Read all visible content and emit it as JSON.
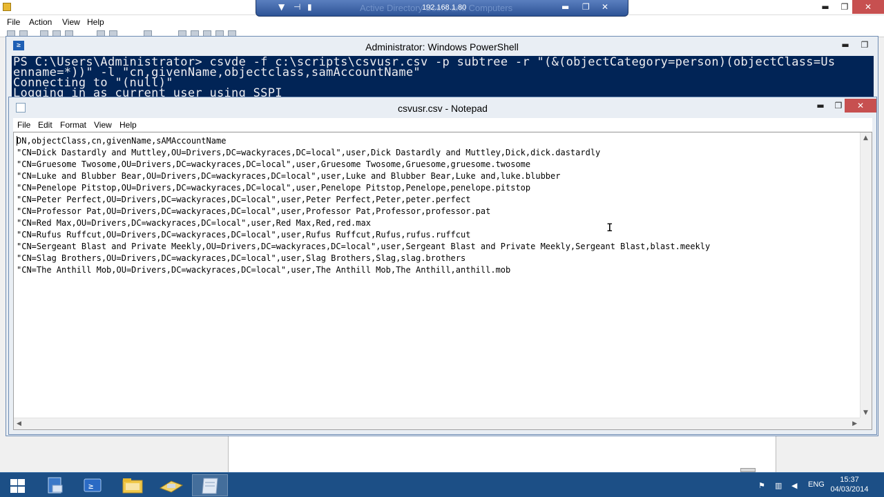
{
  "mmc": {
    "menu": [
      "File",
      "Action",
      "View",
      "Help"
    ],
    "rdp_ip": "192.168.1.80",
    "rdp_ghost_title": "Active Directory Users and Computers"
  },
  "powershell": {
    "title": "Administrator: Windows PowerShell",
    "icon_glyph": "≥",
    "lines": [
      "PS C:\\Users\\Administrator> csvde -f c:\\scripts\\csvusr.csv -p subtree -r \"(&(objectCategory=person)(objectClass=Us",
      "enname=*))\" -l \"cn,givenName,objectclass,samAccountName\"",
      "Connecting to \"(null)\"",
      "Logging in as current user using SSPI"
    ]
  },
  "notepad": {
    "title": "csvusr.csv - Notepad",
    "menu": [
      "File",
      "Edit",
      "Format",
      "View",
      "Help"
    ],
    "lines": [
      "DN,objectClass,cn,givenName,sAMAccountName",
      "\"CN=Dick Dastardly and Muttley,OU=Drivers,DC=wackyraces,DC=local\",user,Dick Dastardly and Muttley,Dick,dick.dastardly",
      "\"CN=Gruesome Twosome,OU=Drivers,DC=wackyraces,DC=local\",user,Gruesome Twosome,Gruesome,gruesome.twosome",
      "\"CN=Luke and Blubber Bear,OU=Drivers,DC=wackyraces,DC=local\",user,Luke and Blubber Bear,Luke and,luke.blubber",
      "\"CN=Penelope Pitstop,OU=Drivers,DC=wackyraces,DC=local\",user,Penelope Pitstop,Penelope,penelope.pitstop",
      "\"CN=Peter Perfect,OU=Drivers,DC=wackyraces,DC=local\",user,Peter Perfect,Peter,peter.perfect",
      "\"CN=Professor Pat,OU=Drivers,DC=wackyraces,DC=local\",user,Professor Pat,Professor,professor.pat",
      "\"CN=Red Max,OU=Drivers,DC=wackyraces,DC=local\",user,Red Max,Red,red.max",
      "\"CN=Rufus Ruffcut,OU=Drivers,DC=wackyraces,DC=local\",user,Rufus Ruffcut,Rufus,rufus.ruffcut",
      "\"CN=Sergeant Blast and Private Meekly,OU=Drivers,DC=wackyraces,DC=local\",user,Sergeant Blast and Private Meekly,Sergeant Blast,blast.meekly",
      "\"CN=Slag Brothers,OU=Drivers,DC=wackyraces,DC=local\",user,Slag Brothers,Slag,slag.brothers",
      "\"CN=The Anthill Mob,OU=Drivers,DC=wackyraces,DC=local\",user,The Anthill Mob,The Anthill,anthill.mob"
    ]
  },
  "window_buttons": {
    "minimize": "▬",
    "maximize": "❐",
    "close": "✕"
  },
  "taskbar": {
    "language": "ENG",
    "time": "15:37",
    "date": "04/03/2014",
    "tray_icons": [
      "flag-icon",
      "network-icon",
      "volume-icon"
    ]
  },
  "colors": {
    "ps_background": "#012456",
    "ps_text": "#eeedf0",
    "taskbar": "#1c4f86",
    "close_button": "#c75050"
  }
}
